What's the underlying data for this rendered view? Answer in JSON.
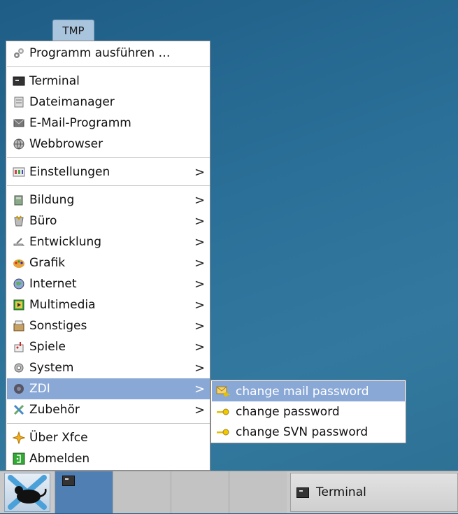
{
  "workspace_label": "TMP",
  "menu": {
    "groups": [
      [
        {
          "label": "Programm ausführen …",
          "icon": "run-gear-icon"
        }
      ],
      [
        {
          "label": "Terminal",
          "icon": "terminal-icon"
        },
        {
          "label": "Dateimanager",
          "icon": "file-manager-icon"
        },
        {
          "label": "E-Mail-Programm",
          "icon": "mail-client-icon"
        },
        {
          "label": "Webbrowser",
          "icon": "web-browser-icon"
        }
      ],
      [
        {
          "label": "Einstellungen",
          "icon": "settings-icon",
          "submenu": true
        }
      ],
      [
        {
          "label": "Bildung",
          "icon": "education-icon",
          "submenu": true
        },
        {
          "label": "Büro",
          "icon": "office-icon",
          "submenu": true
        },
        {
          "label": "Entwicklung",
          "icon": "development-icon",
          "submenu": true
        },
        {
          "label": "Grafik",
          "icon": "graphics-icon",
          "submenu": true
        },
        {
          "label": "Internet",
          "icon": "internet-icon",
          "submenu": true
        },
        {
          "label": "Multimedia",
          "icon": "multimedia-icon",
          "submenu": true
        },
        {
          "label": "Sonstiges",
          "icon": "misc-icon",
          "submenu": true
        },
        {
          "label": "Spiele",
          "icon": "games-icon",
          "submenu": true
        },
        {
          "label": "System",
          "icon": "system-gear-icon",
          "submenu": true
        },
        {
          "label": "ZDI",
          "icon": "zdi-icon",
          "submenu": true,
          "active": true
        },
        {
          "label": "Zubehör",
          "icon": "accessories-icon",
          "submenu": true
        }
      ],
      [
        {
          "label": "Über Xfce",
          "icon": "star-icon"
        },
        {
          "label": "Abmelden",
          "icon": "logout-icon"
        }
      ]
    ],
    "submenu_arrow": ">"
  },
  "zdi_submenu": [
    {
      "label": "change mail password",
      "icon": "mail-key-icon",
      "active": true
    },
    {
      "label": "change password",
      "icon": "key-icon"
    },
    {
      "label": "change SVN password",
      "icon": "key-icon"
    }
  ],
  "taskbar": {
    "task_button_label": "Terminal"
  }
}
